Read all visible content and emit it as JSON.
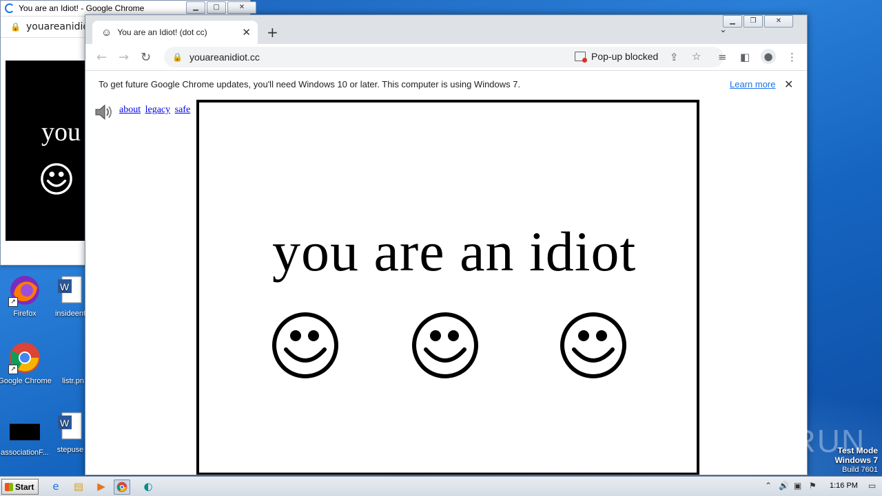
{
  "back_window": {
    "title": "You are an Idiot! - Google Chrome",
    "url": "youareanidiot",
    "content_text": "you"
  },
  "desktop_icons": [
    {
      "label": "Firefox",
      "icon": "firefox-icon"
    },
    {
      "label": "insideent",
      "icon": "word-doc-icon"
    },
    {
      "label": "Google Chrome",
      "icon": "chrome-icon"
    },
    {
      "label": "listr.pn",
      "icon": "image-file-icon"
    },
    {
      "label": "associationF...",
      "icon": "black-file-icon"
    },
    {
      "label": "stepuse",
      "icon": "word-doc-icon"
    }
  ],
  "chrome": {
    "tab_title": "You are an Idiot! (dot cc)",
    "url": "youareanidiot.cc",
    "popup_blocked": "Pop-up blocked",
    "infobar_message": "To get future Google Chrome updates, you'll need Windows 10 or later. This computer is using Windows 7.",
    "learn_more": "Learn more"
  },
  "page": {
    "links": [
      "about",
      "legacy",
      "safe"
    ],
    "headline": "you are an idiot",
    "smiley_count": 3
  },
  "taskbar": {
    "start_label": "Start",
    "clock": "1:16 PM"
  },
  "watermark": {
    "line1": "Test Mode",
    "line2": "Windows 7",
    "line3": "Build 7601",
    "brand": "ANY RUN"
  }
}
